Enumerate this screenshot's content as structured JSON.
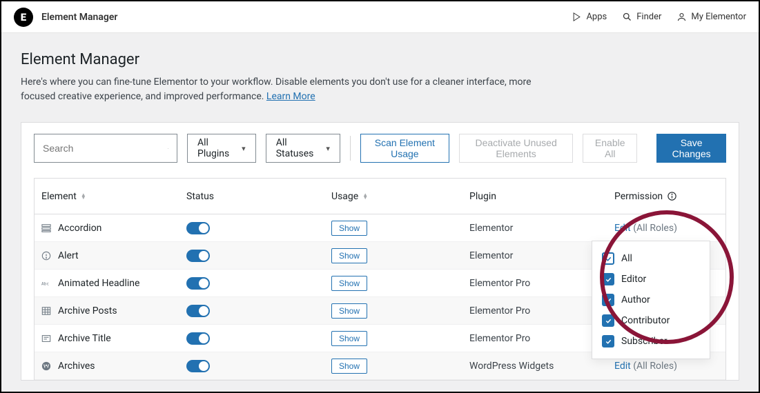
{
  "topbar": {
    "title": "Element Manager",
    "apps": "Apps",
    "finder": "Finder",
    "account": "My Elementor"
  },
  "page": {
    "heading": "Element Manager",
    "description_prefix": "Here's where you can fine-tune Elementor to your workflow. Disable elements you don't use for a cleaner interface, more focused creative experience, and improved performance. ",
    "learn_more": "Learn More"
  },
  "toolbar": {
    "search_placeholder": "Search",
    "plugins_filter": "All Plugins",
    "status_filter": "All Statuses",
    "scan": "Scan Element Usage",
    "deactivate": "Deactivate Unused Elements",
    "enable_all": "Enable All",
    "save": "Save Changes"
  },
  "columns": {
    "element": "Element",
    "status": "Status",
    "usage": "Usage",
    "plugin": "Plugin",
    "permission": "Permission"
  },
  "show_label": "Show",
  "perm_edit": "Edit",
  "perm_roles": "(All Roles)",
  "rows": [
    {
      "name": "Accordion",
      "plugin": "Elementor"
    },
    {
      "name": "Alert",
      "plugin": "Elementor"
    },
    {
      "name": "Animated Headline",
      "plugin": "Elementor Pro"
    },
    {
      "name": "Archive Posts",
      "plugin": "Elementor Pro"
    },
    {
      "name": "Archive Title",
      "plugin": "Elementor Pro"
    },
    {
      "name": "Archives",
      "plugin": "WordPress Widgets"
    }
  ],
  "dropdown": {
    "items": [
      "All",
      "Editor",
      "Author",
      "Contributor",
      "Subscriber"
    ]
  }
}
